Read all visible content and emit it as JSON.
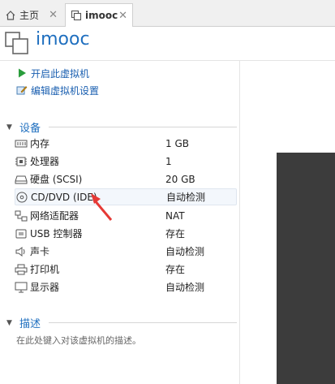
{
  "tabs": [
    {
      "label": "主页",
      "icon": "home-icon"
    },
    {
      "label": "imooc",
      "icon": "vm-tab-icon"
    }
  ],
  "header": {
    "title": "imooc",
    "icon": "vm-icon"
  },
  "actions": [
    {
      "label": "开启此虚拟机",
      "icon": "play-icon"
    },
    {
      "label": "编辑虚拟机设置",
      "icon": "edit-settings-icon"
    }
  ],
  "devices": {
    "section_label": "设备",
    "items": [
      {
        "name": "内存",
        "value": "1 GB",
        "icon": "memory-icon"
      },
      {
        "name": "处理器",
        "value": "1",
        "icon": "processor-icon"
      },
      {
        "name": "硬盘 (SCSI)",
        "value": "20 GB",
        "icon": "hard-disk-icon"
      },
      {
        "name": "CD/DVD (IDE)",
        "value": "自动检测",
        "icon": "cd-dvd-icon"
      },
      {
        "name": "网络适配器",
        "value": "NAT",
        "icon": "network-adapter-icon"
      },
      {
        "name": "USB 控制器",
        "value": "存在",
        "icon": "usb-icon"
      },
      {
        "name": "声卡",
        "value": "自动检测",
        "icon": "sound-card-icon"
      },
      {
        "name": "打印机",
        "value": "存在",
        "icon": "printer-icon"
      },
      {
        "name": "显示器",
        "value": "自动检测",
        "icon": "display-icon"
      }
    ]
  },
  "description": {
    "section_label": "描述",
    "placeholder": "在此处键入对该虚拟机的描述。"
  },
  "colors": {
    "accent": "#1f6fbf",
    "play": "#2a9d3c",
    "arrow": "#e53935",
    "preview": "#3c3c3c"
  }
}
